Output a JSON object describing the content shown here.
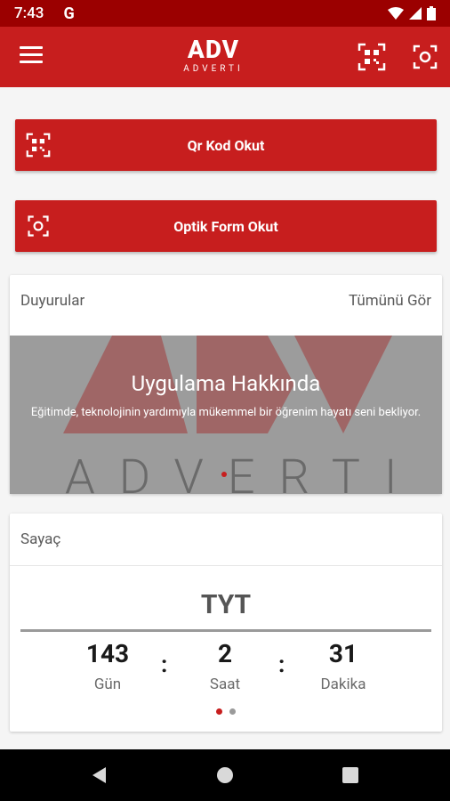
{
  "status_bar": {
    "time": "7:43",
    "app_glyph": "G"
  },
  "app_bar": {
    "logo_mark": "ADV",
    "logo_word": "ADVERTI"
  },
  "actions": {
    "qr_label": "Qr Kod Okut",
    "optik_label": "Optik Form Okut"
  },
  "announcements": {
    "title": "Duyurular",
    "see_all": "Tümünü Gör",
    "slide_title": "Uygulama Hakkında",
    "slide_text": "Eğitimde, teknolojinin yardımıyla mükemmel bir öğrenim hayatı seni bekliyor.",
    "watermark": "ADVERTI"
  },
  "counter": {
    "title": "Sayaç",
    "exam": "TYT",
    "items": [
      {
        "value": "143",
        "label": "Gün"
      },
      {
        "value": "2",
        "label": "Saat"
      },
      {
        "value": "31",
        "label": "Dakika"
      }
    ],
    "separator": ":"
  },
  "colors": {
    "primary": "#c71e1e",
    "status": "#9b0000",
    "banner": "#9c9c9c"
  },
  "icons": [
    "menu-icon",
    "qr-scan-icon",
    "camera-scan-icon",
    "wifi-icon",
    "signal-icon",
    "battery-icon",
    "back-icon",
    "home-icon",
    "recents-icon"
  ]
}
